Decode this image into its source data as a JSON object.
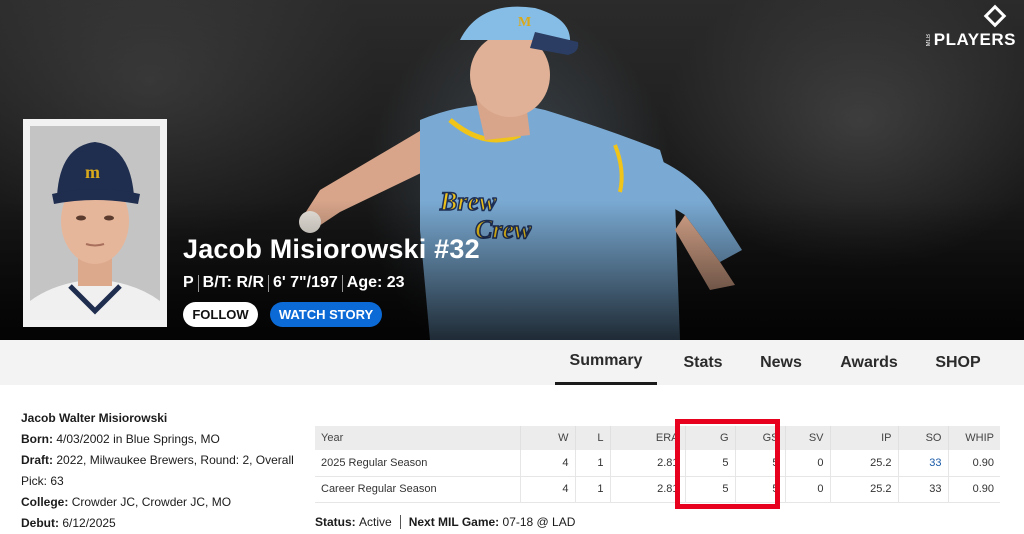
{
  "brand": {
    "logo_text": "PLAYERS",
    "logo_small": "MLB"
  },
  "player": {
    "name_number": "Jacob Misiorowski #32",
    "position": "P",
    "bats_throws": "B/T: R/R",
    "height_weight": "6' 7\"/197",
    "age": "Age: 23",
    "jersey_wordmark_1": "Brew",
    "jersey_wordmark_2": "Crew"
  },
  "actions": {
    "follow": "FOLLOW",
    "watch_story": "WATCH STORY"
  },
  "tabs": [
    {
      "label": "Summary",
      "active": true
    },
    {
      "label": "Stats",
      "active": false
    },
    {
      "label": "News",
      "active": false
    },
    {
      "label": "Awards",
      "active": false
    },
    {
      "label": "SHOP",
      "active": false
    }
  ],
  "bio": {
    "full_name": "Jacob Walter Misiorowski",
    "born_label": "Born:",
    "born": "4/03/2002 in Blue Springs, MO",
    "draft_label": "Draft:",
    "draft": "2022, Milwaukee Brewers, Round: 2, Overall Pick: 63",
    "college_label": "College:",
    "college": "Crowder JC, Crowder JC, MO",
    "debut_label": "Debut:",
    "debut": "6/12/2025"
  },
  "stats_table": {
    "headers": [
      "Year",
      "W",
      "L",
      "ERA",
      "G",
      "GS",
      "SV",
      "IP",
      "SO",
      "WHIP"
    ],
    "rows": [
      [
        "2025 Regular Season",
        "4",
        "1",
        "2.81",
        "5",
        "5",
        "0",
        "25.2",
        "33",
        "0.90"
      ],
      [
        "Career Regular Season",
        "4",
        "1",
        "2.81",
        "5",
        "5",
        "0",
        "25.2",
        "33",
        "0.90"
      ]
    ]
  },
  "status": {
    "status_label": "Status:",
    "status_value": "Active",
    "next_game_label": "Next MIL Game:",
    "next_game_value": "07-18 @ LAD"
  },
  "colors": {
    "accent_blue": "#0c6ad6",
    "highlight_red": "#e8001f",
    "jersey_blue": "#7aaad3",
    "jersey_gold": "#f0c419"
  }
}
